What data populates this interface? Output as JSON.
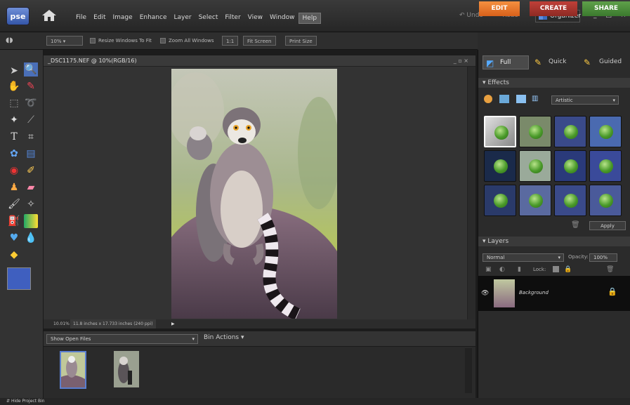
{
  "app": {
    "logo": "pse"
  },
  "menu": [
    "File",
    "Edit",
    "Image",
    "Enhance",
    "Layer",
    "Select",
    "Filter",
    "View",
    "Window",
    "Help"
  ],
  "topbar": {
    "undo": "Undo",
    "redo": "Redo",
    "organizer": "Organizer",
    "window_controls": "_ □ ×"
  },
  "modes": {
    "edit": "EDIT",
    "create": "CREATE",
    "share": "SHARE"
  },
  "options": {
    "zoom": "10%",
    "resize_windows": "Resize Windows To Fit",
    "zoom_all": "Zoom All Windows",
    "one_to_one": "1:1",
    "fit_screen": "Fit Screen",
    "print_size": "Print Size"
  },
  "document": {
    "title": "_DSC1175.NEF @ 10%(RGB/16)",
    "zoom_status": "10.01%",
    "size_status": "11.8 inches x 17.733 inches (240 ppi)"
  },
  "edit_tabs": {
    "full": "Full",
    "quick": "Quick",
    "guided": "Guided"
  },
  "effects": {
    "header": "Effects",
    "category": "Artistic",
    "apply": "Apply"
  },
  "layers": {
    "header": "Layers",
    "blend_mode": "Normal",
    "opacity_label": "Opacity:",
    "opacity": "100%",
    "lock_label": "Lock:",
    "layer_name": "Background"
  },
  "bin": {
    "show": "Show Open Files",
    "actions": "Bin Actions",
    "hide": "Hide Project Bin"
  },
  "colors": {
    "accent_edit": "#e8701e",
    "accent_create": "#b0332b",
    "accent_share": "#4a8a3a",
    "foreground": "#3f5fbf",
    "background_swatch": "#ffffff"
  }
}
